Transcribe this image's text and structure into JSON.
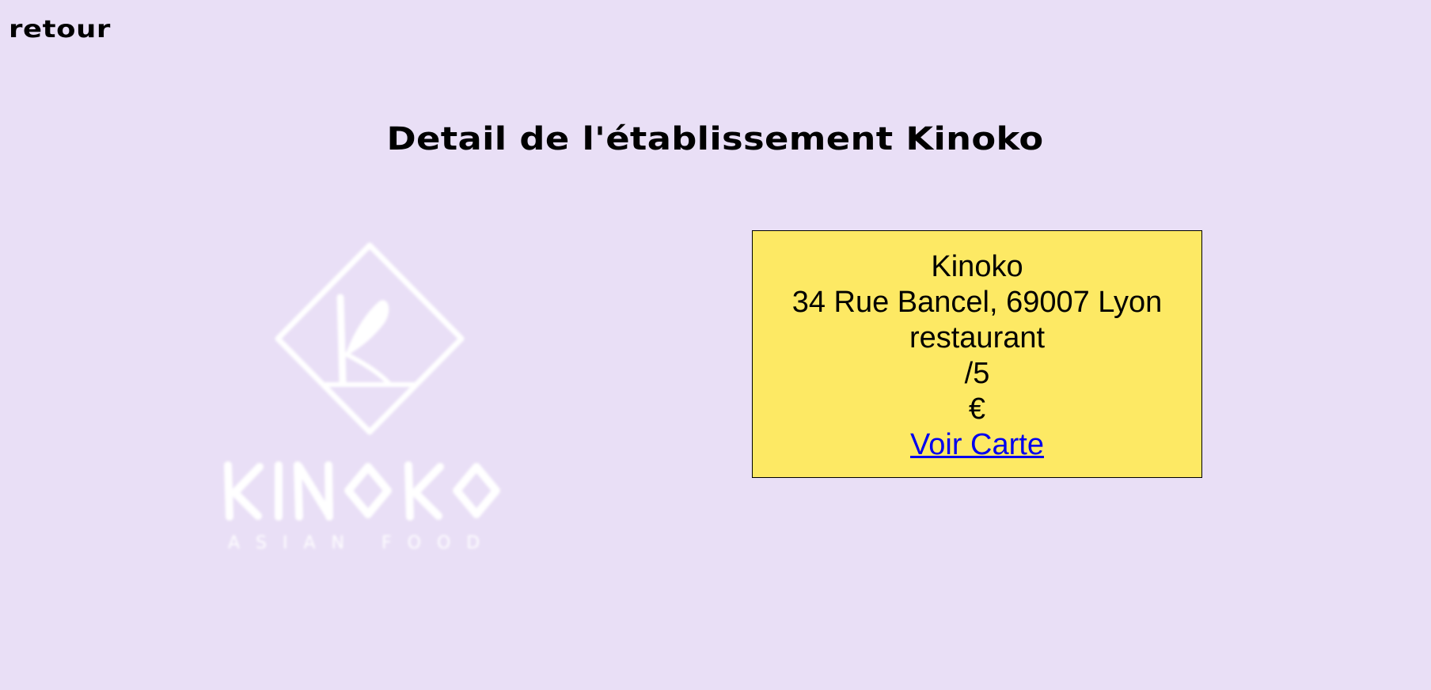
{
  "nav": {
    "back_label": "retour"
  },
  "page": {
    "title": "Detail de l'établissement Kinoko"
  },
  "logo": {
    "text": "KINOKO",
    "subtitle": "ASIAN FOOD",
    "color": "#ffffff"
  },
  "establishment": {
    "name": "Kinoko",
    "address": "34 Rue Bancel, 69007 Lyon",
    "type": "restaurant",
    "rating": "/5",
    "price": "€",
    "menu_link_label": "Voir Carte"
  },
  "colors": {
    "background": "#e9dff6",
    "card_background": "#fde964",
    "link": "#0000ee"
  }
}
